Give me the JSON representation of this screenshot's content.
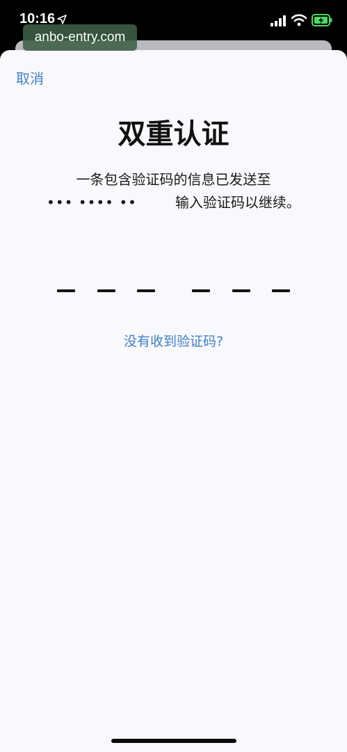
{
  "status_bar": {
    "time": "10:16",
    "icons": [
      "location-arrow-icon",
      "cellular-signal-icon",
      "wifi-icon",
      "battery-charging-icon"
    ]
  },
  "watermark": {
    "text": "anbo-entry.com"
  },
  "sheet": {
    "cancel_label": "取消",
    "title": "双重认证",
    "message_line1": "一条包含验证码的信息已发送至",
    "masked_number": "••• •••• ••",
    "message_line2_suffix": "输入验证码以继续。",
    "code_slots": 6,
    "resend_label": "没有收到验证码?"
  },
  "colors": {
    "link_blue": "#3e7fcb",
    "sheet_background": "#f9f8fc",
    "battery_green": "#4cd964"
  }
}
